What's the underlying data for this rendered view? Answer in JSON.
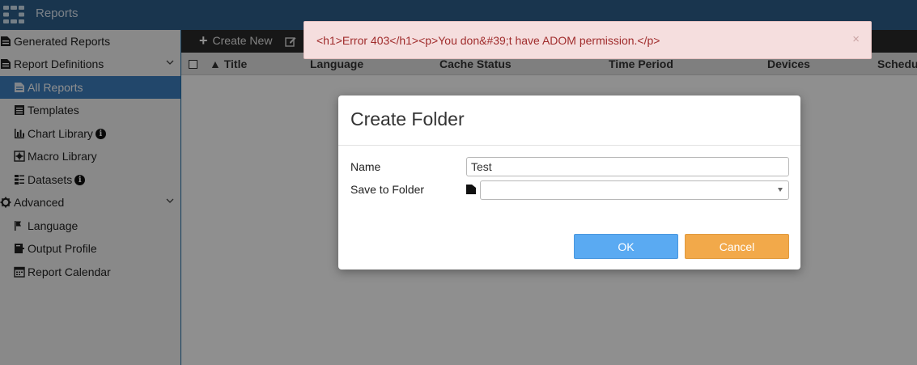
{
  "app": {
    "title": "Reports"
  },
  "sidebar": {
    "items": [
      {
        "label": "Generated Reports",
        "icon": "document-icon"
      },
      {
        "label": "Report Definitions",
        "icon": "document-icon",
        "expanded": true
      },
      {
        "label": "All Reports",
        "icon": "document-icon",
        "active": true
      },
      {
        "label": "Templates",
        "icon": "template-icon"
      },
      {
        "label": "Chart Library",
        "icon": "bar-chart-icon",
        "info": true
      },
      {
        "label": "Macro Library",
        "icon": "macro-icon"
      },
      {
        "label": "Datasets",
        "icon": "dataset-icon",
        "info": true
      },
      {
        "label": "Advanced",
        "icon": "gear-icon",
        "expanded": true
      },
      {
        "label": "Language",
        "icon": "flag-icon"
      },
      {
        "label": "Output Profile",
        "icon": "output-icon"
      },
      {
        "label": "Report Calendar",
        "icon": "calendar-icon"
      }
    ],
    "info_glyph": "i"
  },
  "toolbar": {
    "create_new_label": "Create New",
    "plus_glyph": "+"
  },
  "table": {
    "columns": [
      "▲ Title",
      "Language",
      "Cache Status",
      "Time Period",
      "Devices",
      "Schedul"
    ]
  },
  "toast": {
    "message": "<h1>Error 403</h1><p>You don&#39;t have ADOM permission.</p>",
    "close_glyph": "×"
  },
  "dialog": {
    "title": "Create Folder",
    "name_label": "Name",
    "name_value": "Test",
    "folder_label": "Save to Folder",
    "folder_value": "",
    "ok_label": "OK",
    "cancel_label": "Cancel"
  },
  "colors": {
    "topbar": "#2d5f8c",
    "active_item": "#3d7fbf",
    "ok_button": "#5aaaf2",
    "cancel_button": "#f2a94a",
    "error_text": "#a02c2c",
    "error_bg": "#f5dede"
  }
}
